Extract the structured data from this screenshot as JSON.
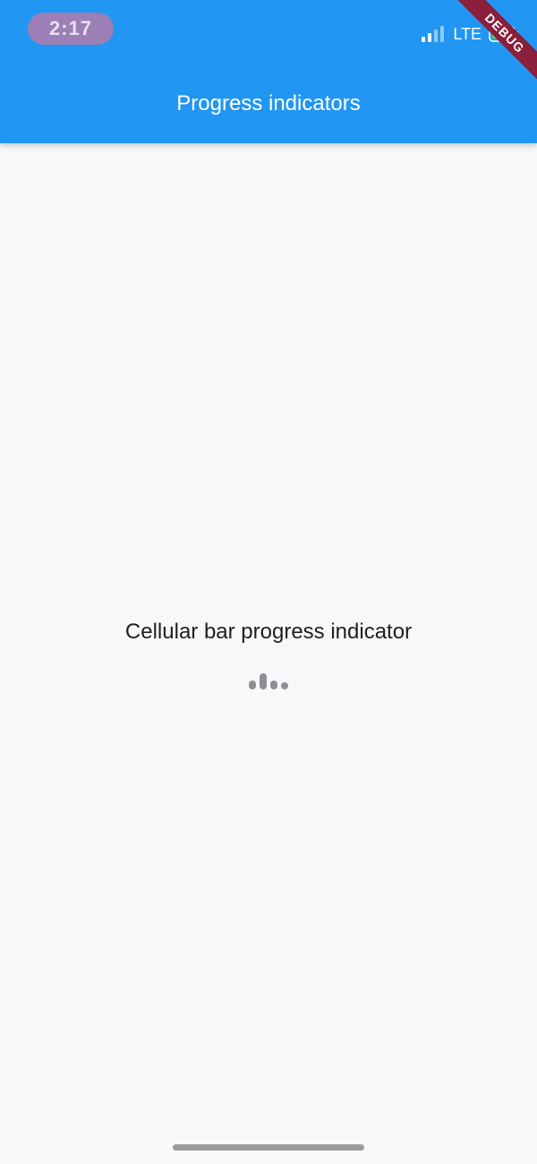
{
  "status_bar": {
    "time": "2:17",
    "network": "LTE"
  },
  "app_bar": {
    "title": "Progress indicators"
  },
  "debug_banner": {
    "label": "DEBUG"
  },
  "main": {
    "indicator_label": "Cellular bar progress indicator"
  },
  "colors": {
    "app_bar": "#2196f3",
    "background": "#f8f7fa",
    "indicator": "#8e8e93",
    "debug_banner": "#8a1f3b"
  },
  "icons": [
    "signal-icon",
    "battery-icon",
    "cellular-progress-indicator"
  ]
}
